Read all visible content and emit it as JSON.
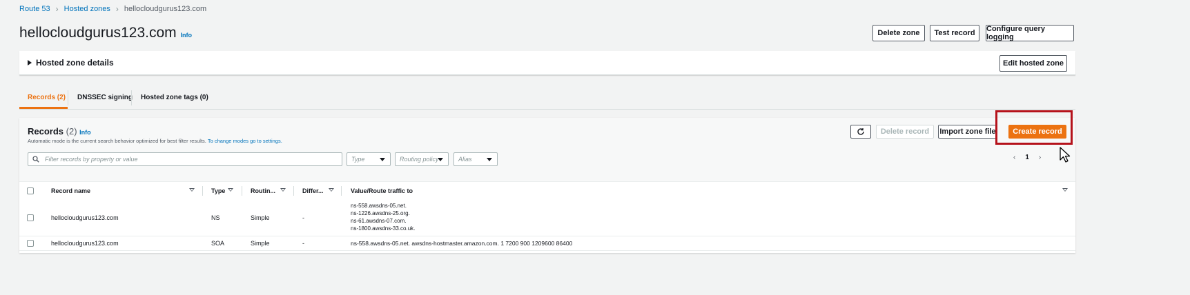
{
  "breadcrumb": {
    "root": "Route 53",
    "section": "Hosted zones",
    "current": "hellocloudgurus123.com"
  },
  "header": {
    "title": "hellocloudgurus123.com",
    "info": "Info",
    "delete_zone": "Delete zone",
    "test_record": "Test record",
    "configure_query_logging": "Configure query logging"
  },
  "details": {
    "label": "Hosted zone details",
    "edit": "Edit hosted zone"
  },
  "tabs": [
    {
      "label": "Records (2)"
    },
    {
      "label": "DNSSEC signing"
    },
    {
      "label": "Hosted zone tags (0)"
    }
  ],
  "records": {
    "title": "Records",
    "count": "(2)",
    "info": "Info",
    "description": "Automatic mode is the current search behavior optimized for best filter results.",
    "description_link": "To change modes go to settings.",
    "delete_record": "Delete record",
    "import_zone_file": "Import zone file",
    "create_record": "Create record",
    "search_placeholder": "Filter records by property or value",
    "filters": {
      "type": "Type",
      "routing_policy": "Routing policy",
      "alias": "Alias"
    },
    "pager": {
      "page": "1"
    }
  },
  "table": {
    "columns": {
      "record_name": "Record name",
      "type": "Type",
      "routing": "Routin...",
      "differ": "Differ...",
      "value": "Value/Route traffic to"
    },
    "rows": [
      {
        "name": "hellocloudgurus123.com",
        "type": "NS",
        "routing": "Simple",
        "differ": "-",
        "values": [
          "ns-558.awsdns-05.net.",
          "ns-1226.awsdns-25.org.",
          "ns-61.awsdns-07.com.",
          "ns-1800.awsdns-33.co.uk."
        ]
      },
      {
        "name": "hellocloudgurus123.com",
        "type": "SOA",
        "routing": "Simple",
        "differ": "-",
        "value": "ns-558.awsdns-05.net. awsdns-hostmaster.amazon.com. 1 7200 900 1209600 86400"
      }
    ]
  },
  "colors": {
    "accent": "#ec7211",
    "link": "#0073bb",
    "highlight": "#b5121b"
  }
}
